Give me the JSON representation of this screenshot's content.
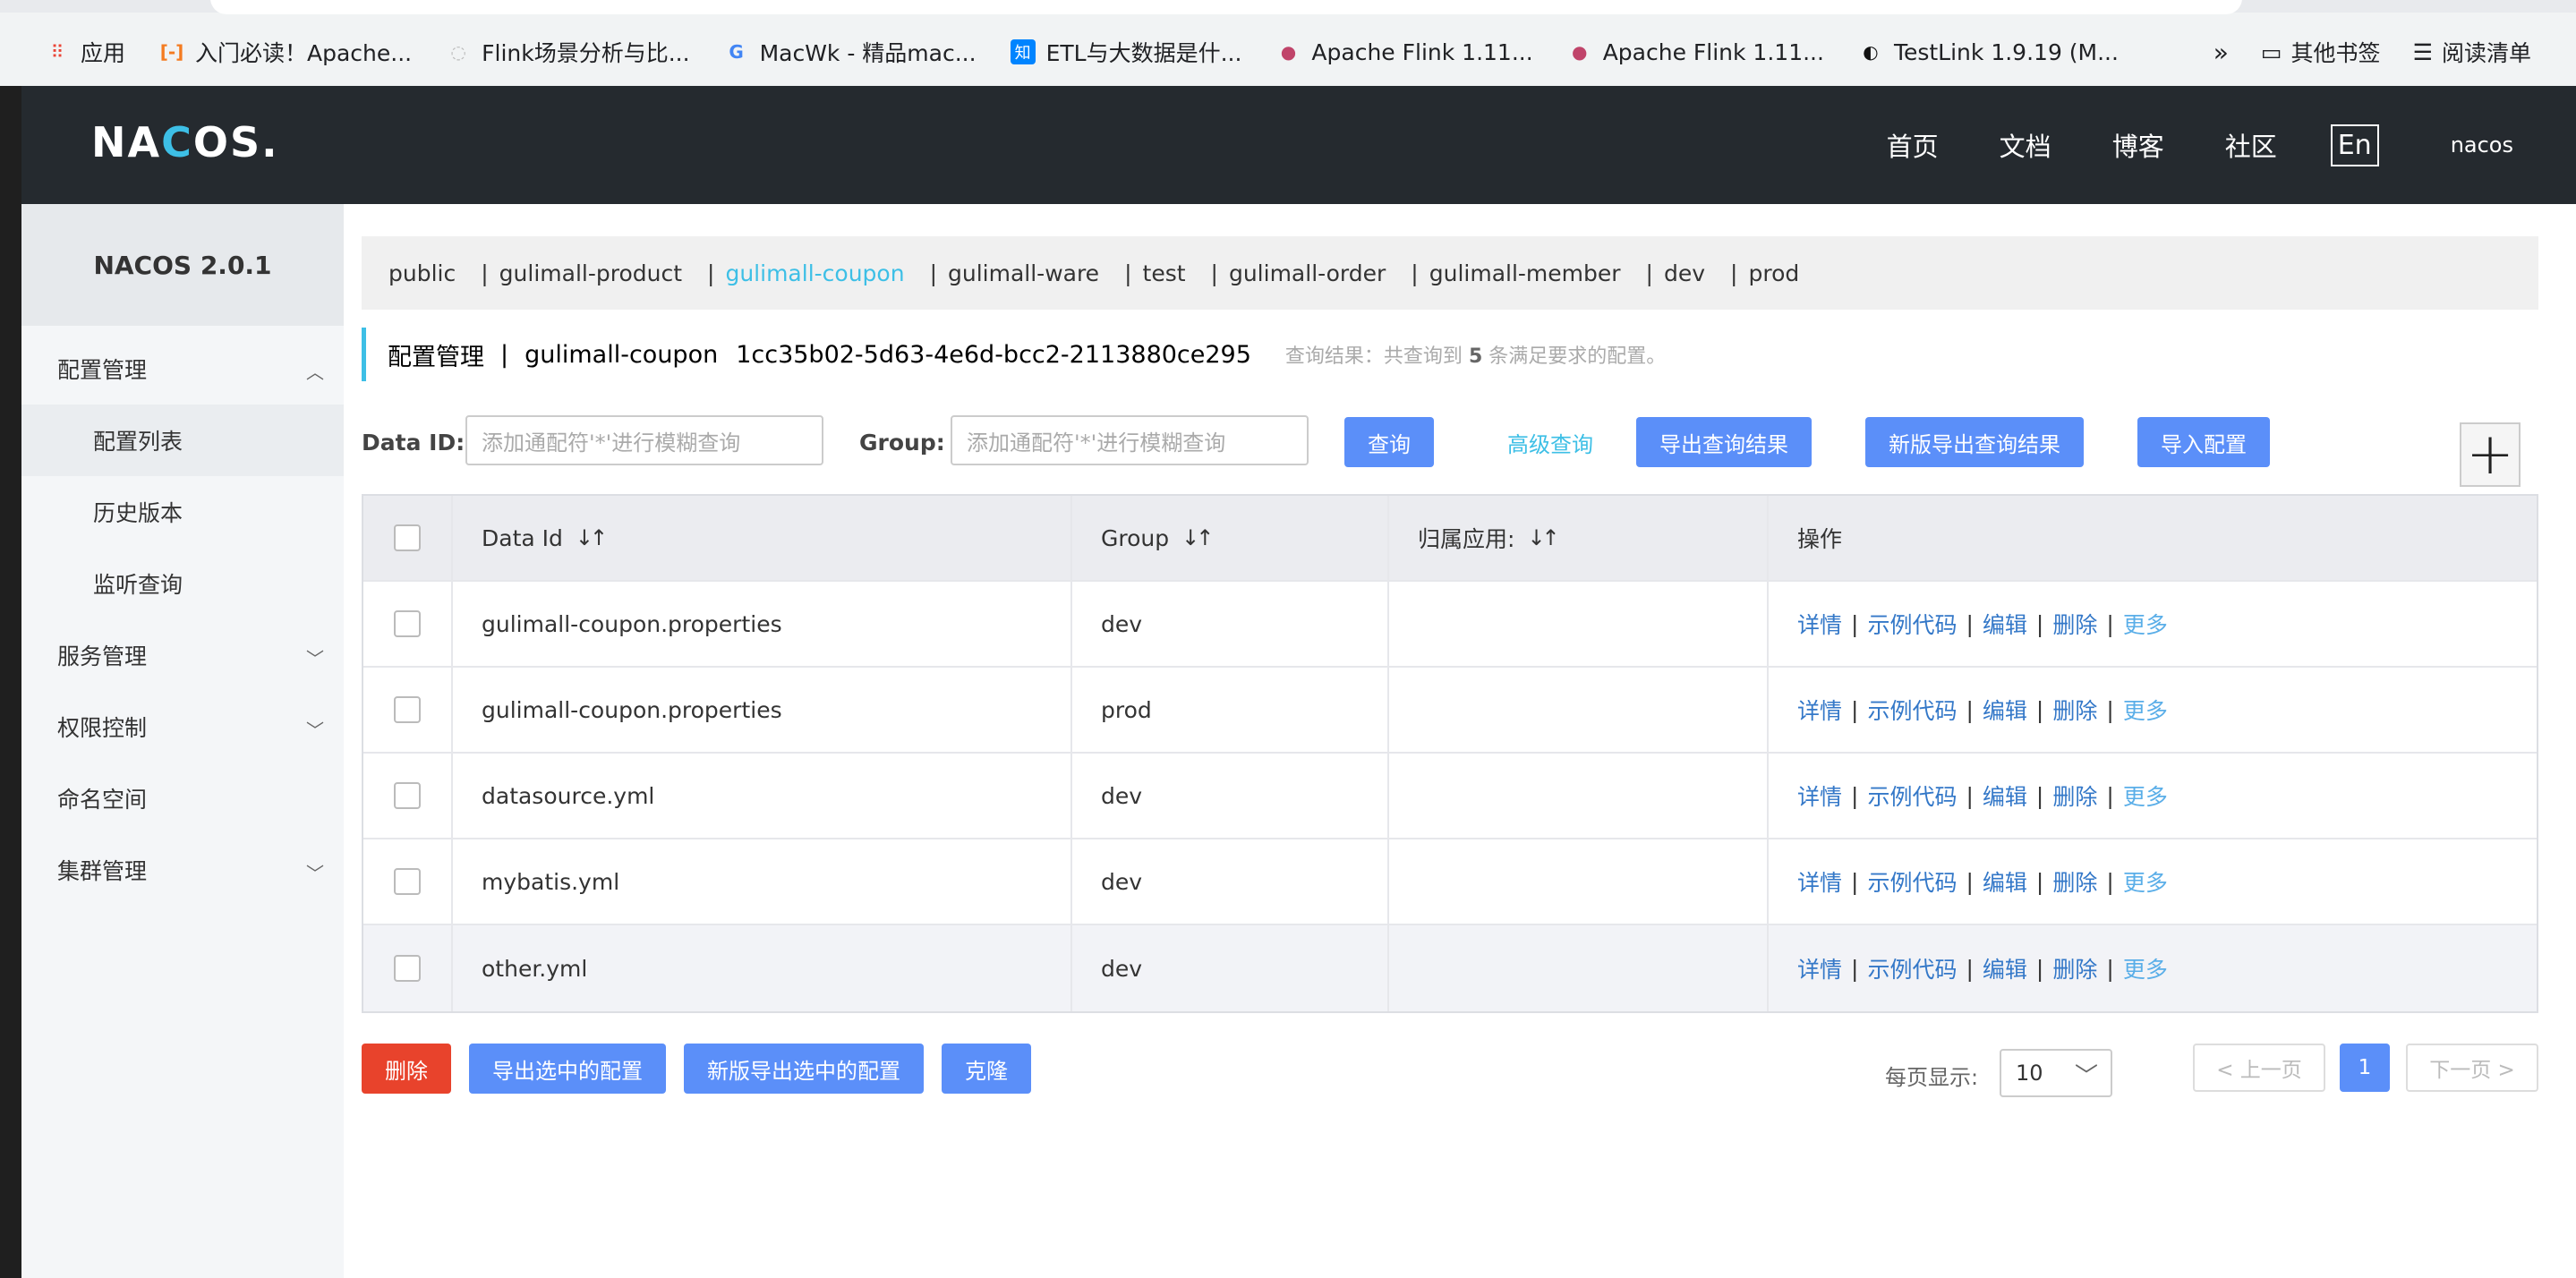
{
  "bookmarks": [
    {
      "icon": "apps-grid-icon",
      "label": "应用"
    },
    {
      "icon": "bracket-icon",
      "label": "入门必读！Apache..."
    },
    {
      "icon": "globe-icon",
      "label": "Flink场景分析与比..."
    },
    {
      "icon": "g-logo-icon",
      "label": "MacWk - 精品mac..."
    },
    {
      "icon": "zhihu-icon",
      "label": "ETL与大数据是什..."
    },
    {
      "icon": "squirrel-icon",
      "label": "Apache Flink 1.11..."
    },
    {
      "icon": "squirrel-icon",
      "label": "Apache Flink 1.11..."
    },
    {
      "icon": "testlink-icon",
      "label": "TestLink 1.9.19 (M..."
    }
  ],
  "bookmarks_more": "»",
  "bookmarks_other": "其他书签",
  "reading_list": "阅读清单",
  "header": {
    "logo_a": "NA",
    "logo_b": "C",
    "logo_c": "OS.",
    "nav": [
      "首页",
      "文档",
      "博客",
      "社区"
    ],
    "lang": "En",
    "user": "nacos"
  },
  "sidebar": {
    "title": "NACOS 2.0.1",
    "config_mgmt": "配置管理",
    "config_list": "配置列表",
    "history": "历史版本",
    "listen_query": "监听查询",
    "service_mgmt": "服务管理",
    "auth": "权限控制",
    "namespace": "命名空间",
    "cluster": "集群管理"
  },
  "namespaces": [
    "public",
    "gulimall-product",
    "gulimall-coupon",
    "gulimall-ware",
    "test",
    "gulimall-order",
    "gulimall-member",
    "dev",
    "prod"
  ],
  "active_namespace": "gulimall-coupon",
  "title": {
    "section": "配置管理",
    "sep": "|",
    "namespace": "gulimall-coupon",
    "namespace_id": "1cc35b02-5d63-4e6d-bcc2-2113880ce295",
    "hint_prefix": "查询结果：共查询到",
    "hint_count": "5",
    "hint_suffix": "条满足要求的配置。"
  },
  "search": {
    "dataid_label": "Data ID:",
    "dataid_placeholder": "添加通配符'*'进行模糊查询",
    "group_label": "Group:",
    "group_placeholder": "添加通配符'*'进行模糊查询",
    "query": "查询",
    "advanced": "高级查询",
    "export": "导出查询结果",
    "export_new": "新版导出查询结果",
    "import": "导入配置"
  },
  "table": {
    "headers": [
      "Data Id",
      "Group",
      "归属应用:",
      "操作"
    ],
    "rows": [
      {
        "data_id": "gulimall-coupon.properties",
        "group": "dev",
        "app": ""
      },
      {
        "data_id": "gulimall-coupon.properties",
        "group": "prod",
        "app": ""
      },
      {
        "data_id": "datasource.yml",
        "group": "dev",
        "app": ""
      },
      {
        "data_id": "mybatis.yml",
        "group": "dev",
        "app": ""
      },
      {
        "data_id": "other.yml",
        "group": "dev",
        "app": ""
      }
    ],
    "ops": [
      "详情",
      "示例代码",
      "编辑",
      "删除",
      "更多"
    ],
    "op_sep": "|"
  },
  "footer": {
    "delete": "删除",
    "export_selected": "导出选中的配置",
    "export_selected_new": "新版导出选中的配置",
    "clone": "克隆",
    "page_size_label": "每页显示:",
    "page_size": "10",
    "prev": "< 上一页",
    "current_page": "1",
    "next": "下一页 >"
  }
}
